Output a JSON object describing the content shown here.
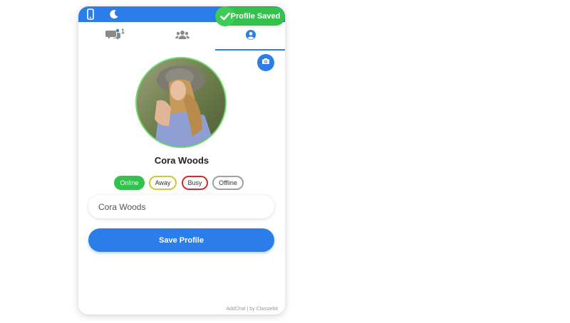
{
  "header": {
    "icons": [
      "mobile-icon",
      "moon-icon"
    ],
    "tabs": [
      {
        "name": "chats",
        "icon": "chats-icon",
        "badge": "1"
      },
      {
        "name": "contacts",
        "icon": "users-icon"
      },
      {
        "name": "profile",
        "icon": "user-circle-icon",
        "active": true
      }
    ]
  },
  "toast": {
    "text": "Profile Saved",
    "icon": "check-icon"
  },
  "profile": {
    "camera_icon": "camera-icon",
    "name": "Cora Woods",
    "status_options": [
      "Online",
      "Away",
      "Busy",
      "Offline"
    ],
    "selected_status": "Online",
    "name_field_value": "Cora Woods",
    "save_label": "Save Profile"
  },
  "footer": {
    "text": "AddChat | by Classiebit"
  },
  "colors": {
    "primary": "#2b7de9",
    "online": "#33c24d",
    "away": "#c9c93a",
    "busy": "#d62b2b",
    "offline": "#a0a0a0"
  }
}
